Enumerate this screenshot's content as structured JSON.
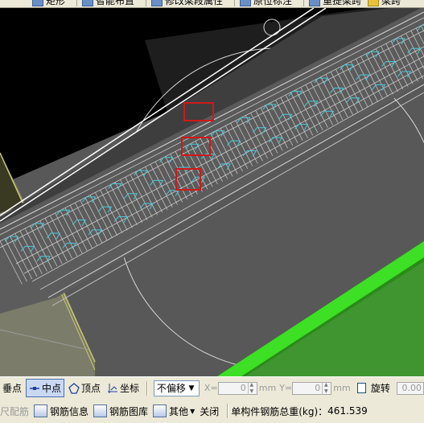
{
  "top_toolbar": {
    "items": [
      {
        "label": "矩形",
        "icon": "rectangle-icon"
      },
      {
        "label": "智能布置",
        "icon": "smart-layout-icon"
      },
      {
        "label": "修改梁段属性",
        "icon": "edit-beam-icon"
      },
      {
        "label": "原位标注",
        "icon": "in-place-annotation-icon"
      },
      {
        "label": "重提梁跨",
        "icon": "re-extract-span-icon"
      },
      {
        "label": "梁跨",
        "icon": "beam-span-icon"
      }
    ]
  },
  "viewport": {
    "highlight_boxes_count": 3,
    "colors": {
      "background": "#000000",
      "slab": "#5a5a5a",
      "beam_green": "#2fd11e",
      "rebar_cyan": "#40c8d8",
      "highlight": "#d01818",
      "column_yellow": "#b8b86a"
    }
  },
  "snap_toolbar": {
    "perpendicular": "垂点",
    "midpoint": "中点",
    "vertex": "顶点",
    "coordinate": "坐标",
    "offset_option": "不偏移",
    "x_label": "X=",
    "x_value": "0",
    "y_label": "Y=",
    "y_value": "0",
    "unit": "mm",
    "rotate_label": "旋转",
    "rotate_value": "0.00"
  },
  "bottom_toolbar": {
    "rebar_scale": "缩尺配筋",
    "rebar_info": "钢筋信息",
    "rebar_library": "钢筋图库",
    "other": "其他",
    "close": "关闭",
    "weight_label": "单构件钢筋总重(kg)：",
    "weight_value": "461.539"
  }
}
